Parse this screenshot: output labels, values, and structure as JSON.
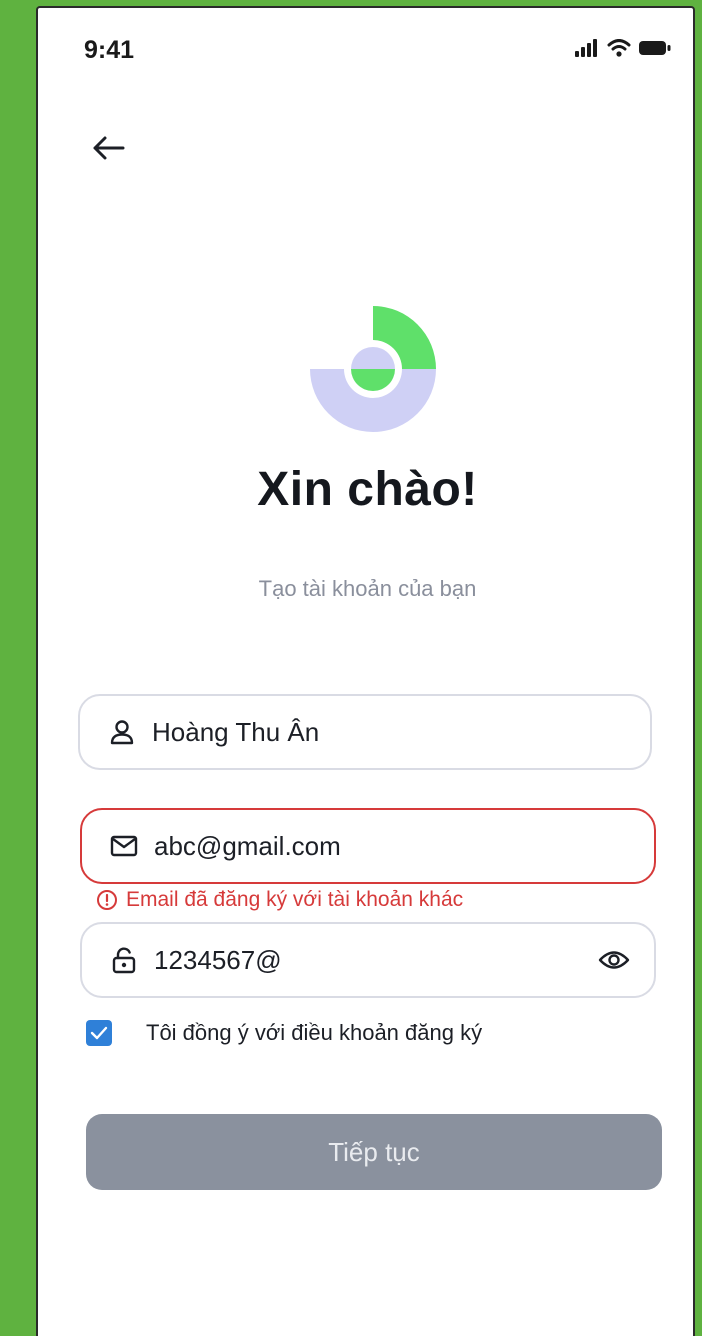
{
  "status_bar": {
    "time": "9:41",
    "icons": [
      "signal-icon",
      "wifi-icon",
      "battery-icon"
    ]
  },
  "header": {
    "back_icon": "arrow-left-icon"
  },
  "greeting": {
    "title": "Xin chào!",
    "subtitle": "Tạo tài khoản của bạn"
  },
  "form": {
    "name": {
      "icon": "user-icon",
      "value": "Hoàng Thu Ân"
    },
    "email": {
      "icon": "mail-icon",
      "value": "abc@gmail.com",
      "error": "Email đã đăng ký với tài khoản khác",
      "error_icon": "alert-circle-icon"
    },
    "password": {
      "icon": "lock-icon",
      "value": "1234567@",
      "toggle_icon": "eye-icon"
    },
    "agree": {
      "checked": true,
      "label": "Tôi đồng ý với điều khoản đăng ký"
    },
    "submit_label": "Tiếp tục"
  },
  "colors": {
    "background": "#5fb240",
    "error": "#d63a3a",
    "checkbox": "#2f80d8",
    "button_disabled": "#8a919e",
    "logo_green": "#5fe06a",
    "logo_lavender": "#cfd0f5"
  }
}
